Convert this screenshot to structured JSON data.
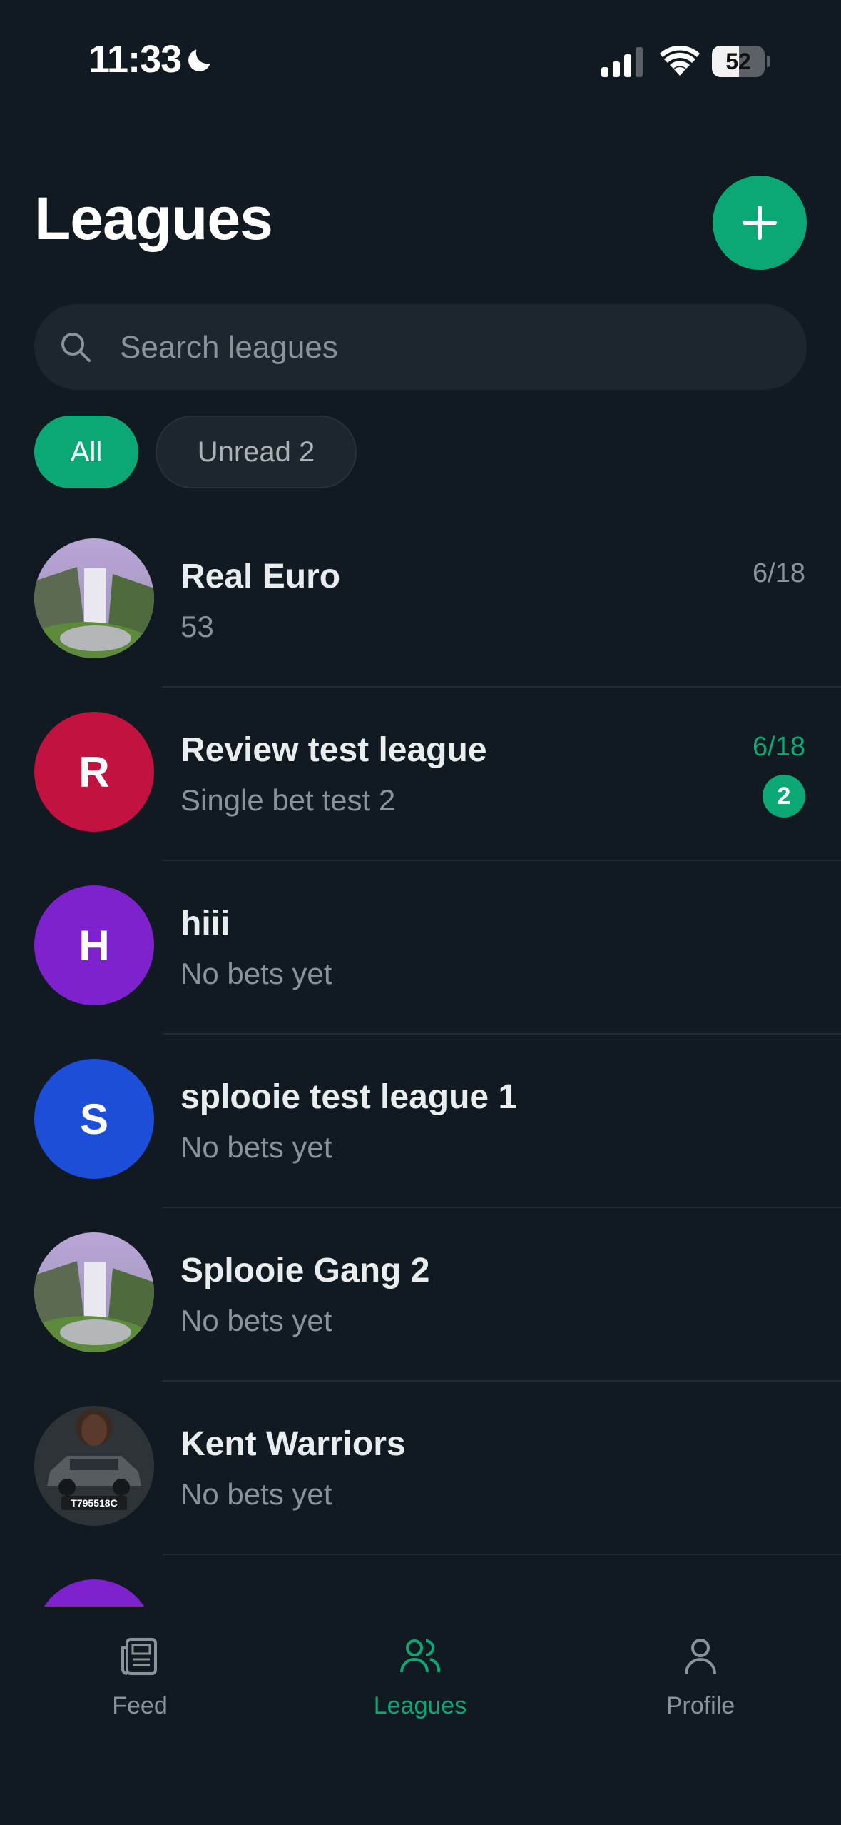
{
  "status_bar": {
    "time": "11:33",
    "battery_level": "52",
    "icons": [
      "moon-icon",
      "signal-icon",
      "wifi-icon",
      "battery-icon"
    ]
  },
  "header": {
    "title": "Leagues",
    "add_icon": "plus-icon"
  },
  "search": {
    "placeholder": "Search leagues",
    "icon": "search-icon"
  },
  "filters": {
    "all_label": "All",
    "unread_label": "Unread 2",
    "selected": "All"
  },
  "colors": {
    "accent": "#0ba875",
    "background": "#111a20",
    "surface": "#1d262c"
  },
  "leagues": [
    {
      "name": "Real Euro",
      "subtitle": "53",
      "date": "6/18",
      "avatar": "waterfall-image",
      "unread": false
    },
    {
      "name": "Review test league",
      "subtitle": "Single bet test 2",
      "date": "6/18",
      "unread_count": "2",
      "avatar_letter": "R",
      "avatar_color": "#c2123f",
      "unread": true
    },
    {
      "name": "hiii",
      "subtitle": "No bets yet",
      "avatar_letter": "H",
      "avatar_color": "#7e22ce",
      "unread": false
    },
    {
      "name": "splooie test league 1",
      "subtitle": "No bets yet",
      "avatar_letter": "S",
      "avatar_color": "#1d4ed8",
      "unread": false
    },
    {
      "name": "Splooie Gang 2",
      "subtitle": "No bets yet",
      "avatar": "waterfall-image",
      "unread": false
    },
    {
      "name": "Kent Warriors",
      "subtitle": "No bets yet",
      "avatar": "car-photo",
      "avatar_caption": "T795518C",
      "unread": false
    },
    {
      "avatar_color": "#7e22ce"
    }
  ],
  "tab_bar": {
    "tabs": [
      {
        "label": "Feed",
        "icon": "newspaper-icon"
      },
      {
        "label": "Leagues",
        "icon": "users-icon",
        "active": true
      },
      {
        "label": "Profile",
        "icon": "user-icon"
      }
    ]
  }
}
